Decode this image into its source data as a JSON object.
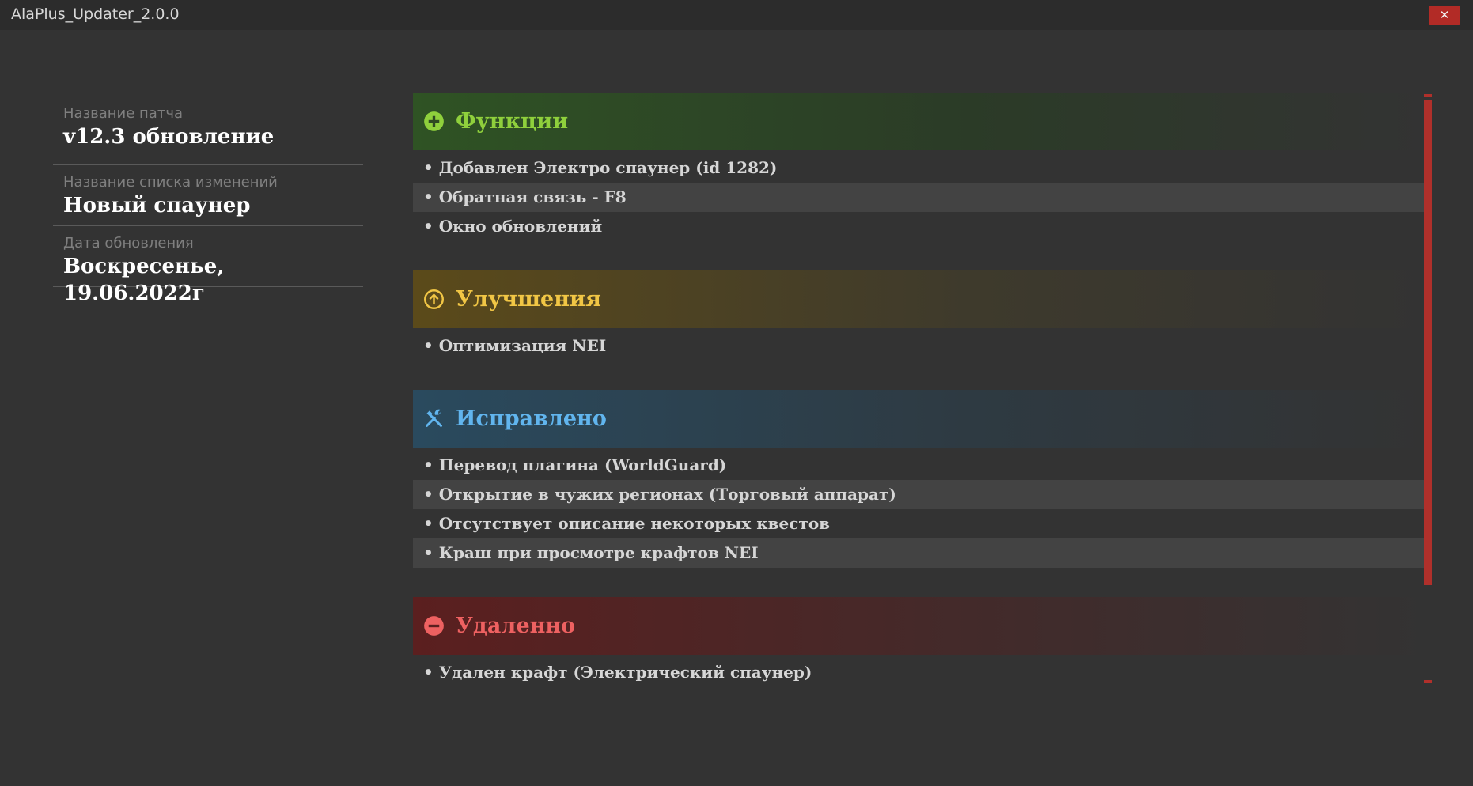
{
  "window": {
    "title": "AlaPlus_Updater_2.0.0",
    "close_label": "✕"
  },
  "info": {
    "patch_name_label": "Название патча",
    "patch_name": "v12.3 обновление",
    "changelog_name_label": "Название списка изменений",
    "changelog_name": "Новый спаунер",
    "update_date_label": "Дата обновления",
    "update_date": "Воскресенье, 19.06.2022г"
  },
  "sections": [
    {
      "title": "Функции",
      "icon": "plus-circle-icon",
      "color": "#8fd03c",
      "items": [
        "• Добавлен Электро спаунер (id 1282)",
        "• Обратная связь - F8",
        "• Окно обновлений"
      ]
    },
    {
      "title": "Улучшения",
      "icon": "arrow-up-circle-icon",
      "color": "#f1c645",
      "items": [
        "• Оптимизация NEI"
      ]
    },
    {
      "title": "Исправлено",
      "icon": "tools-icon",
      "color": "#61b5ee",
      "items": [
        "• Перевод плагина (WorldGuard)",
        "• Открытие в чужих регионах (Торговый аппарат)",
        "• Отсутствует описание некоторых квестов",
        "• Краш при просмотре крафтов NEI"
      ]
    },
    {
      "title": "Удаленно",
      "icon": "minus-circle-icon",
      "color": "#ee6161",
      "items": [
        "• Удален крафт (Электрический спаунер)"
      ]
    }
  ],
  "colors": {
    "background": "#333333",
    "titlebar": "#2c2c2c",
    "accent_red": "#b0302b"
  }
}
